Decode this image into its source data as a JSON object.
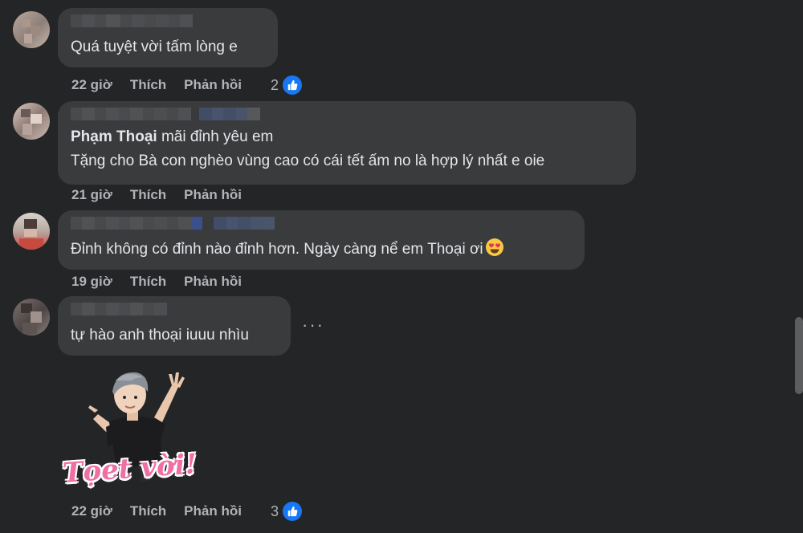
{
  "comments": [
    {
      "text": "Quá tuyệt vời tấm lòng e",
      "time": "22 giờ",
      "like": "Thích",
      "reply": "Phản hồi",
      "reaction_count": "2"
    },
    {
      "mention": "Phạm Thoại",
      "text": " mãi đỉnh yêu em",
      "text2": "Tặng cho Bà con nghèo vùng cao có cái tết ấm no là hợp lý nhất e oie",
      "time": "21 giờ",
      "like": "Thích",
      "reply": "Phản hồi"
    },
    {
      "text": "Đỉnh không có đỉnh nào đỉnh hơn. Ngày càng nể em Thoại ơi",
      "time": "19 giờ",
      "like": "Thích",
      "reply": "Phản hồi"
    },
    {
      "text": "tự hào anh thoại iuuu nhìu",
      "sticker_text": "Tọet vời!",
      "time": "22 giờ",
      "like": "Thích",
      "reply": "Phản hồi",
      "reaction_count": "3"
    }
  ],
  "icons": {
    "like": "thumbs-up-icon",
    "more": "more-options-icon",
    "emoji": "heart-eyes-emoji-icon"
  },
  "colors": {
    "background": "#242526",
    "bubble": "#3a3b3c",
    "like_blue": "#1877f2"
  }
}
